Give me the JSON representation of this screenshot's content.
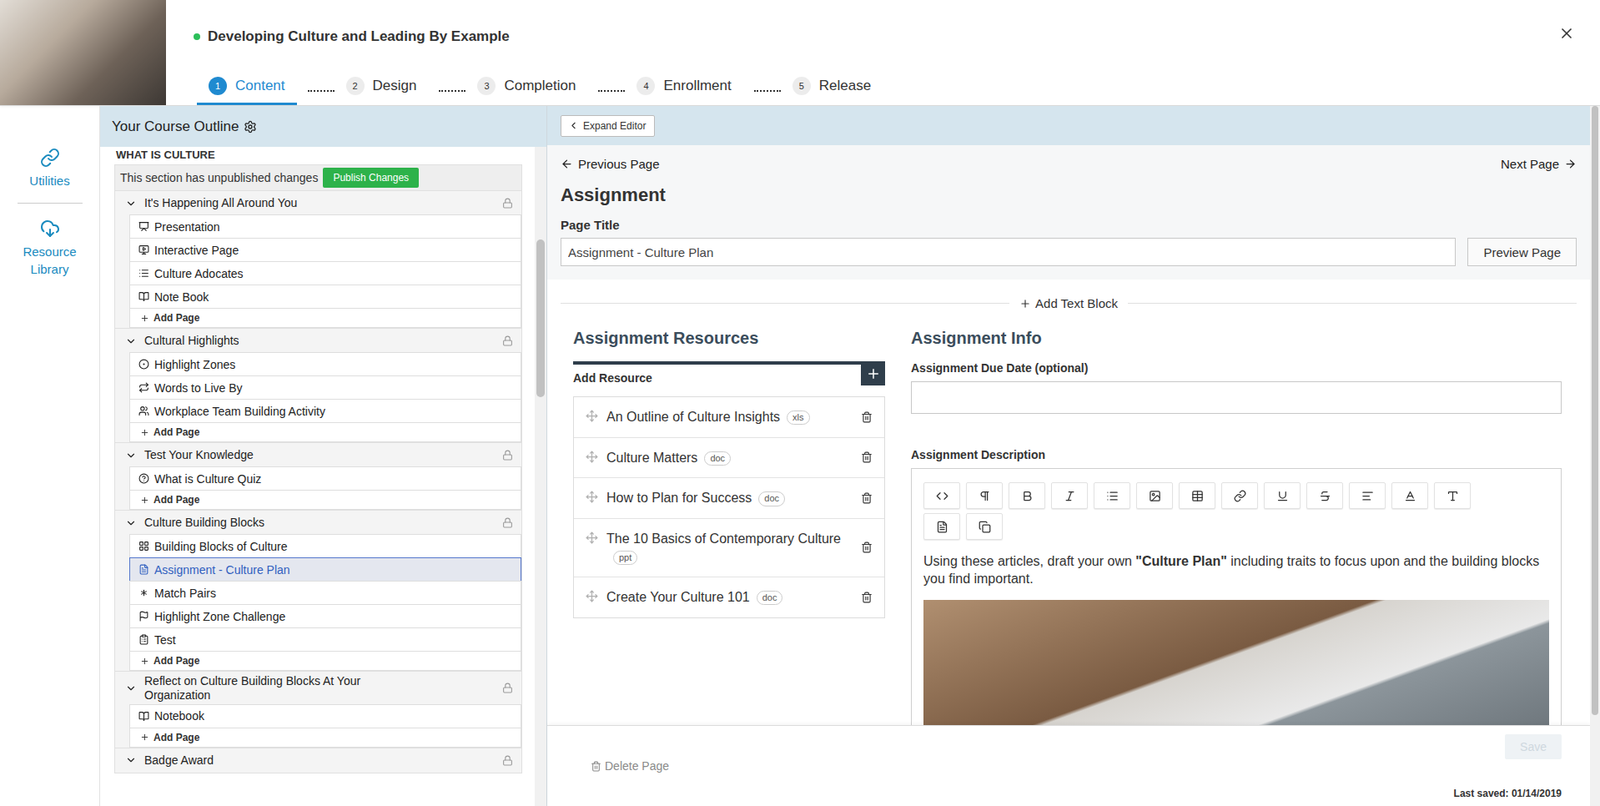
{
  "header": {
    "title": "Developing Culture and Leading By Example",
    "active": true,
    "steps": [
      {
        "number": "1",
        "label": "Content",
        "selected": true
      },
      {
        "number": "2",
        "label": "Design",
        "selected": false
      },
      {
        "number": "3",
        "label": "Completion",
        "selected": false
      },
      {
        "number": "4",
        "label": "Enrollment",
        "selected": false
      },
      {
        "number": "5",
        "label": "Release",
        "selected": false
      }
    ]
  },
  "rail": [
    {
      "label": "Utilities",
      "kind": "utilities"
    },
    {
      "label": "Resource Library",
      "kind": "library"
    }
  ],
  "outline": {
    "title": "Your Course Outline",
    "section": "WHAT IS CULTURE",
    "notice": "This section has unpublished changes",
    "publish_button": "Publish Changes",
    "add_page": "Add Page",
    "scroll": {
      "position": 0.14,
      "size": 0.24
    },
    "modules": [
      {
        "title": "It's Happening All Around You",
        "expanded": true,
        "locked": true,
        "pages": [
          {
            "title": "Presentation",
            "kind": "presentation",
            "selected": false
          },
          {
            "title": "Interactive Page",
            "kind": "interactive",
            "selected": false
          },
          {
            "title": "Culture Adocates",
            "kind": "list",
            "selected": false
          },
          {
            "title": "Note Book",
            "kind": "notebook",
            "selected": false
          }
        ]
      },
      {
        "title": "Cultural Highlights",
        "expanded": true,
        "locked": true,
        "pages": [
          {
            "title": "Highlight Zones",
            "kind": "zones",
            "selected": false
          },
          {
            "title": "Words to Live By",
            "kind": "words",
            "selected": false
          },
          {
            "title": "Workplace Team Building Activity",
            "kind": "activity",
            "selected": false
          }
        ]
      },
      {
        "title": "Test Your Knowledge",
        "expanded": true,
        "locked": true,
        "pages": [
          {
            "title": "What is Culture Quiz",
            "kind": "quiz",
            "selected": false
          }
        ]
      },
      {
        "title": "Culture Building Blocks",
        "expanded": true,
        "locked": true,
        "pages": [
          {
            "title": "Building Blocks of Culture",
            "kind": "blocks",
            "selected": false
          },
          {
            "title": "Assignment - Culture Plan",
            "kind": "assignment",
            "selected": true
          },
          {
            "title": "Match Pairs",
            "kind": "match",
            "selected": false
          },
          {
            "title": "Highlight Zone Challenge",
            "kind": "challenge",
            "selected": false
          },
          {
            "title": "Test",
            "kind": "test",
            "selected": false
          }
        ]
      },
      {
        "title": "Reflect on Culture Building Blocks At Your Organization",
        "expanded": true,
        "locked": true,
        "pages": [
          {
            "title": "Notebook",
            "kind": "notebook",
            "selected": false
          }
        ]
      },
      {
        "title": "Badge Award",
        "expanded": true,
        "locked": true,
        "pages": []
      }
    ]
  },
  "editor": {
    "expand_button": "Expand Editor",
    "previous": "Previous Page",
    "next": "Next Page",
    "page_type": "Assignment",
    "page_title_label": "Page Title",
    "page_title_value": "Assignment - Culture Plan",
    "preview_button": "Preview Page",
    "add_text_block": "Add Text Block",
    "scroll": {
      "position": 0.0,
      "size": 0.87
    },
    "resources": {
      "title": "Assignment Resources",
      "add_label": "Add Resource",
      "items": [
        {
          "name": "An Outline of Culture Insights",
          "type": "xls"
        },
        {
          "name": "Culture Matters",
          "type": "doc"
        },
        {
          "name": "How to Plan for Success",
          "type": "doc"
        },
        {
          "name": "The 10 Basics of Contemporary Culture",
          "type": "ppt"
        },
        {
          "name": "Create Your Culture 101",
          "type": "doc"
        }
      ]
    },
    "info": {
      "title": "Assignment Info",
      "due_label": "Assignment Due Date (optional)",
      "due_value": "",
      "description_label": "Assignment Description",
      "description": [
        {
          "text": "Using these articles, draft your own ",
          "bold": false
        },
        {
          "text": "\"Culture Plan\"",
          "bold": true
        },
        {
          "text": " including traits to focus upon and the building blocks you find important.",
          "bold": false
        }
      ]
    }
  },
  "footer": {
    "delete": "Delete Page",
    "save": "Save",
    "save_disabled": true,
    "last_saved": "Last saved: 01/14/2019"
  }
}
